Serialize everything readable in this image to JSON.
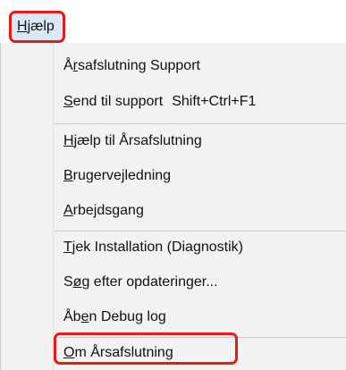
{
  "menu": {
    "title_underlined": "H",
    "title_rest": "jælp"
  },
  "items": [
    {
      "pre": "Å",
      "ul": "r",
      "post": "safslutning Support",
      "shortcut": ""
    },
    {
      "pre": "",
      "ul": "S",
      "post": "end til support",
      "shortcut": "Shift+Ctrl+F1"
    },
    {
      "pre": "",
      "ul": "H",
      "post": "jælp til Årsafslutning",
      "shortcut": ""
    },
    {
      "pre": "",
      "ul": "B",
      "post": "rugervejledning",
      "shortcut": ""
    },
    {
      "pre": "",
      "ul": "A",
      "post": "rbejdsgang",
      "shortcut": ""
    },
    {
      "pre": "",
      "ul": "T",
      "post": "jek Installation (Diagnostik)",
      "shortcut": ""
    },
    {
      "pre": "S",
      "ul": "ø",
      "post": "g efter opdateringer...",
      "shortcut": ""
    },
    {
      "pre": "Åb",
      "ul": "e",
      "post": "n Debug log",
      "shortcut": ""
    },
    {
      "pre": "",
      "ul": "O",
      "post": "m Årsafslutning",
      "shortcut": ""
    }
  ],
  "background": {
    "fragment_glyph": ")"
  },
  "colors": {
    "highlight_border": "#e31b1b",
    "menu_title_bg": "#dbe8f7",
    "menu_bg": "#f2f2f2"
  }
}
